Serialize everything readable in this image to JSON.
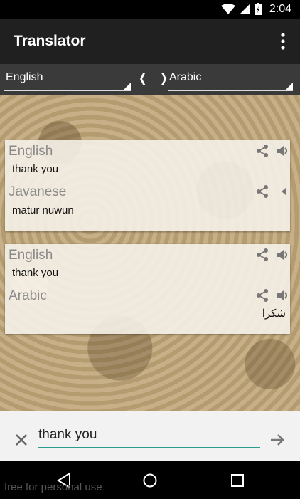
{
  "status": {
    "time": "2:04"
  },
  "app": {
    "title": "Translator"
  },
  "language_bar": {
    "source": "English",
    "target": "Arabic",
    "swap": "❬ ❭"
  },
  "history": [
    {
      "source_lang": "English",
      "source_text": "thank you",
      "target_lang": "Javanese",
      "target_text": "matur nuwun"
    },
    {
      "source_lang": "English",
      "source_text": "thank you",
      "target_lang": "Arabic",
      "target_text": "شكرا"
    }
  ],
  "input": {
    "value": "thank you"
  },
  "watermark": "free for personal use",
  "icons": {
    "share": "share-icon",
    "speaker": "speaker-icon",
    "clear": "close-icon",
    "send": "arrow-right-icon",
    "overflow": "more-vert-icon"
  },
  "colors": {
    "accent": "#2a9d8f",
    "appbar": "#202020",
    "langbar": "#3a3a3a"
  }
}
